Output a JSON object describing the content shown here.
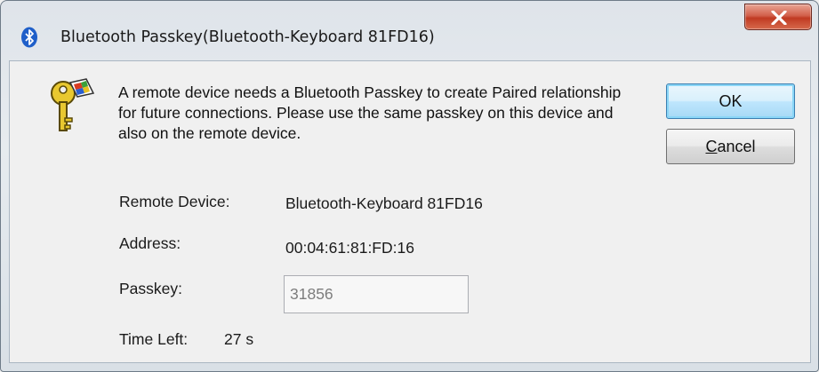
{
  "window": {
    "title": "Bluetooth Passkey(Bluetooth-Keyboard 81FD16)",
    "title_icon": "bluetooth-icon",
    "close_icon": "close-icon"
  },
  "message": "A remote device needs a Bluetooth Passkey to create Paired relationship for future connections. Please use the same passkey on this device and also on the remote device.",
  "buttons": {
    "ok_label": "OK",
    "cancel_prefix": "",
    "cancel_underlined": "C",
    "cancel_rest": "ancel"
  },
  "fields": {
    "remote_device_label": "Remote Device:",
    "remote_device_value": "Bluetooth-Keyboard 81FD16",
    "address_label": "Address:",
    "address_value": "00:04:61:81:FD:16",
    "passkey_label": "Passkey:",
    "passkey_value": "31856",
    "time_left_label": "Time Left:",
    "time_left_value": "27 s"
  },
  "icons": {
    "key": "key-icon"
  },
  "colors": {
    "close_button": "#c8452d",
    "bluetooth_blue": "#1f5fc9",
    "ok_border": "#3c7fb1"
  }
}
